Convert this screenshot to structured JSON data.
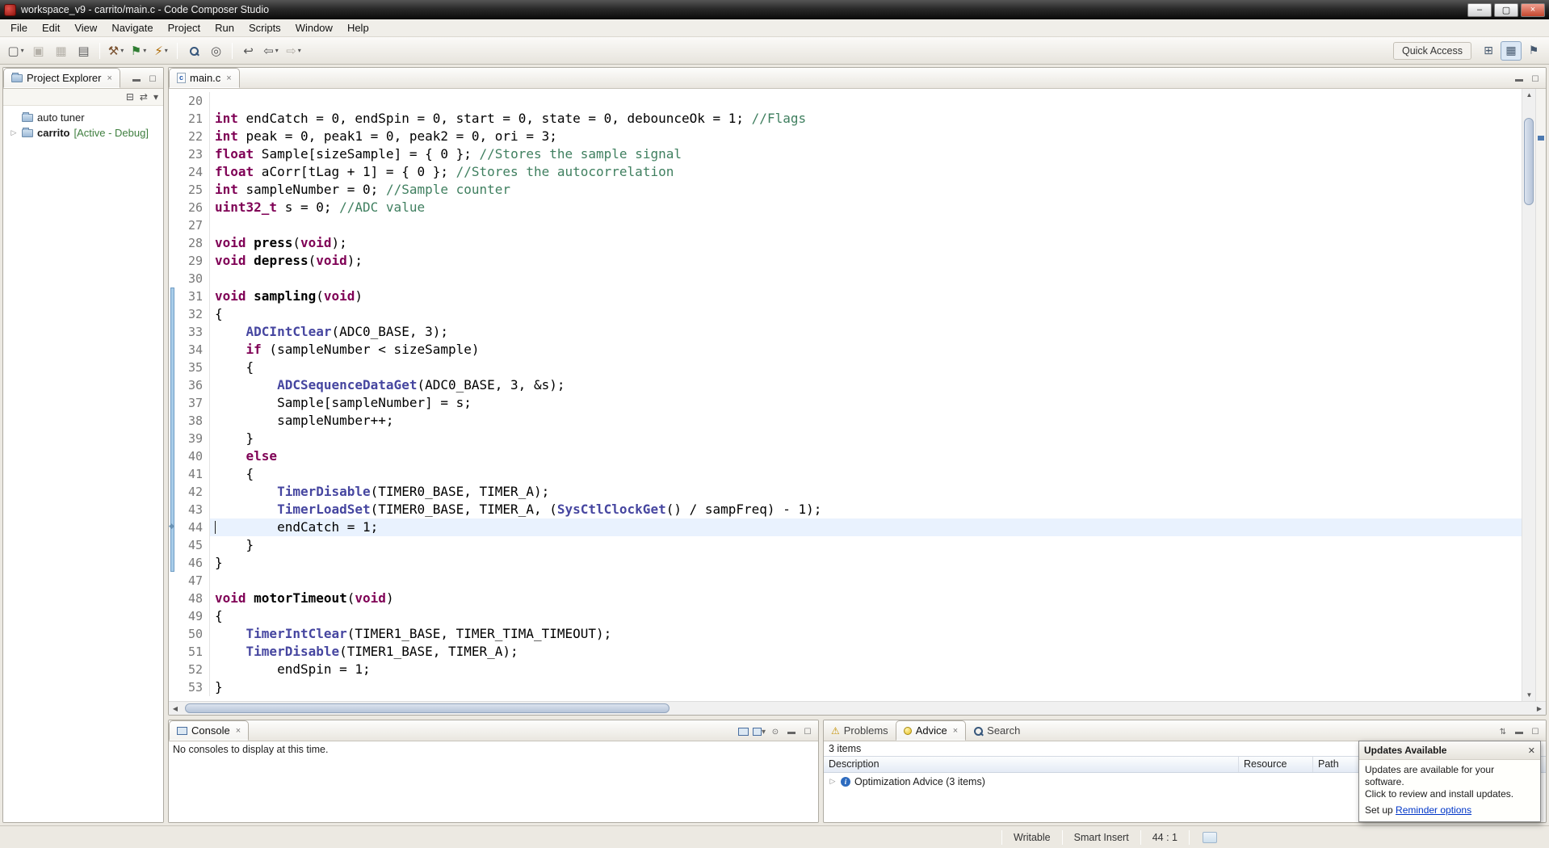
{
  "window": {
    "title": "workspace_v9 - carrito/main.c - Code Composer Studio"
  },
  "menubar": {
    "items": [
      "File",
      "Edit",
      "View",
      "Navigate",
      "Project",
      "Run",
      "Scripts",
      "Window",
      "Help"
    ]
  },
  "toolbar": {
    "quick_access_label": "Quick Access",
    "buttons": [
      {
        "name": "new-button",
        "glyph": "▢",
        "dropdown": true,
        "color": "#5b5b5b"
      },
      {
        "name": "save-button",
        "glyph": "▣",
        "disabled": true
      },
      {
        "name": "save-all-button",
        "glyph": "▦",
        "disabled": true
      },
      {
        "name": "print-button",
        "glyph": "▤",
        "color": "#5b5b5b"
      },
      {
        "sep": true
      },
      {
        "name": "build-button",
        "glyph": "⚒",
        "dropdown": true,
        "color": "#7a5230"
      },
      {
        "name": "debug-button",
        "glyph": "⚑",
        "dropdown": true,
        "color": "#2f7d32"
      },
      {
        "name": "flash-button",
        "glyph": "⚡",
        "dropdown": true,
        "color": "#b06a00"
      },
      {
        "sep": true
      },
      {
        "name": "search-button",
        "glyph": "",
        "mag": true
      },
      {
        "name": "open-element-button",
        "glyph": "◎",
        "color": "#555555"
      },
      {
        "sep": true
      },
      {
        "name": "last-edit-location-button",
        "glyph": "↩",
        "color": "#555555"
      },
      {
        "name": "back-button",
        "glyph": "⇦",
        "dropdown": true,
        "color": "#555555"
      },
      {
        "name": "forward-button",
        "glyph": "⇨",
        "dropdown": true,
        "disabled": true
      }
    ]
  },
  "project_explorer": {
    "tab_label": "Project Explorer",
    "items": [
      {
        "label": "auto tuner",
        "suffix": ""
      },
      {
        "label": "carrito",
        "suffix": " [Active - Debug]"
      }
    ]
  },
  "editor": {
    "tab_label": "main.c",
    "cursor_line": 44,
    "range_start": 31,
    "range_end": 46,
    "lines": [
      {
        "n": 20,
        "s": []
      },
      {
        "n": 21,
        "s": [
          [
            "k",
            "int"
          ],
          [
            "p",
            " endCatch = 0, endSpin = 0, start = 0, state = 0, debounceOk = 1; "
          ],
          [
            "c",
            "//Flags"
          ]
        ]
      },
      {
        "n": 22,
        "s": [
          [
            "k",
            "int"
          ],
          [
            "p",
            " peak = 0, peak1 = 0, peak2 = 0, ori = 3;"
          ]
        ]
      },
      {
        "n": 23,
        "s": [
          [
            "k",
            "float"
          ],
          [
            "p",
            " Sample[sizeSample] = { 0 }; "
          ],
          [
            "c",
            "//Stores the sample signal"
          ]
        ]
      },
      {
        "n": 24,
        "s": [
          [
            "k",
            "float"
          ],
          [
            "p",
            " aCorr[tLag + 1] = { 0 }; "
          ],
          [
            "c",
            "//Stores the autocorrelation"
          ]
        ]
      },
      {
        "n": 25,
        "s": [
          [
            "k",
            "int"
          ],
          [
            "p",
            " sampleNumber = 0; "
          ],
          [
            "c",
            "//Sample counter"
          ]
        ]
      },
      {
        "n": 26,
        "s": [
          [
            "k",
            "uint32_t"
          ],
          [
            "p",
            " s = 0; "
          ],
          [
            "c",
            "//ADC value"
          ]
        ]
      },
      {
        "n": 27,
        "s": []
      },
      {
        "n": 28,
        "s": [
          [
            "k",
            "void"
          ],
          [
            "p",
            " "
          ],
          [
            "d",
            "press"
          ],
          [
            "p",
            "("
          ],
          [
            "k",
            "void"
          ],
          [
            "p",
            ");"
          ]
        ]
      },
      {
        "n": 29,
        "s": [
          [
            "k",
            "void"
          ],
          [
            "p",
            " "
          ],
          [
            "d",
            "depress"
          ],
          [
            "p",
            "("
          ],
          [
            "k",
            "void"
          ],
          [
            "p",
            ");"
          ]
        ]
      },
      {
        "n": 30,
        "s": []
      },
      {
        "n": 31,
        "s": [
          [
            "k",
            "void"
          ],
          [
            "p",
            " "
          ],
          [
            "d",
            "sampling"
          ],
          [
            "p",
            "("
          ],
          [
            "k",
            "void"
          ],
          [
            "p",
            ")"
          ]
        ]
      },
      {
        "n": 32,
        "s": [
          [
            "p",
            "{"
          ]
        ]
      },
      {
        "n": 33,
        "s": [
          [
            "p",
            "    "
          ],
          [
            "f",
            "ADCIntClear"
          ],
          [
            "p",
            "(ADC0_BASE, 3);"
          ]
        ]
      },
      {
        "n": 34,
        "s": [
          [
            "p",
            "    "
          ],
          [
            "k",
            "if"
          ],
          [
            "p",
            " (sampleNumber < sizeSample)"
          ]
        ]
      },
      {
        "n": 35,
        "s": [
          [
            "p",
            "    {"
          ]
        ]
      },
      {
        "n": 36,
        "s": [
          [
            "p",
            "        "
          ],
          [
            "f",
            "ADCSequenceDataGet"
          ],
          [
            "p",
            "(ADC0_BASE, 3, &s);"
          ]
        ]
      },
      {
        "n": 37,
        "s": [
          [
            "p",
            "        Sample[sampleNumber] = s;"
          ]
        ]
      },
      {
        "n": 38,
        "s": [
          [
            "p",
            "        sampleNumber++;"
          ]
        ]
      },
      {
        "n": 39,
        "s": [
          [
            "p",
            "    }"
          ]
        ]
      },
      {
        "n": 40,
        "s": [
          [
            "p",
            "    "
          ],
          [
            "k",
            "else"
          ]
        ]
      },
      {
        "n": 41,
        "s": [
          [
            "p",
            "    {"
          ]
        ]
      },
      {
        "n": 42,
        "s": [
          [
            "p",
            "        "
          ],
          [
            "f",
            "TimerDisable"
          ],
          [
            "p",
            "(TIMER0_BASE, TIMER_A);"
          ]
        ]
      },
      {
        "n": 43,
        "s": [
          [
            "p",
            "        "
          ],
          [
            "f",
            "TimerLoadSet"
          ],
          [
            "p",
            "(TIMER0_BASE, TIMER_A, ("
          ],
          [
            "f",
            "SysCtlClockGet"
          ],
          [
            "p",
            "() / sampFreq) - 1);"
          ]
        ]
      },
      {
        "n": 44,
        "h": true,
        "s": [
          [
            "p",
            "        endCatch = 1;"
          ]
        ]
      },
      {
        "n": 45,
        "s": [
          [
            "p",
            "    }"
          ]
        ]
      },
      {
        "n": 46,
        "s": [
          [
            "p",
            "}"
          ]
        ]
      },
      {
        "n": 47,
        "s": []
      },
      {
        "n": 48,
        "s": [
          [
            "k",
            "void"
          ],
          [
            "p",
            " "
          ],
          [
            "d",
            "motorTimeout"
          ],
          [
            "p",
            "("
          ],
          [
            "k",
            "void"
          ],
          [
            "p",
            ")"
          ]
        ]
      },
      {
        "n": 49,
        "s": [
          [
            "p",
            "{"
          ]
        ]
      },
      {
        "n": 50,
        "s": [
          [
            "p",
            "    "
          ],
          [
            "f",
            "TimerIntClear"
          ],
          [
            "p",
            "(TIMER1_BASE, TIMER_TIMA_TIMEOUT);"
          ]
        ]
      },
      {
        "n": 51,
        "s": [
          [
            "p",
            "    "
          ],
          [
            "f",
            "TimerDisable"
          ],
          [
            "p",
            "(TIMER1_BASE, TIMER_A);"
          ]
        ]
      },
      {
        "n": 52,
        "s": [
          [
            "p",
            "        endSpin = 1;"
          ]
        ]
      },
      {
        "n": 53,
        "s": [
          [
            "p",
            "}"
          ]
        ]
      }
    ]
  },
  "console": {
    "tab_label": "Console",
    "message": "No consoles to display at this time."
  },
  "advice_panel": {
    "tabs": [
      {
        "label": "Problems"
      },
      {
        "label": "Advice",
        "active": true
      },
      {
        "label": "Search"
      }
    ],
    "items_count": "3 items",
    "columns": [
      "Description",
      "Resource",
      "Path"
    ],
    "rows": [
      {
        "description": "Optimization Advice (3 items)"
      }
    ]
  },
  "updates_popup": {
    "title": "Updates Available",
    "line1": "Updates are available for your software.",
    "line2": "Click to review and install updates.",
    "footer_prefix": "Set up ",
    "footer_link": "Reminder options"
  },
  "statusbar": {
    "writable": "Writable",
    "insert_mode": "Smart Insert",
    "caret_position": "44 : 1"
  },
  "colors": {
    "keyword": "#7f0055",
    "comment": "#3f7f5f",
    "function": "#4646a0",
    "current_line": "#e9f2fe",
    "active_suffix": "#3f7f3f"
  }
}
